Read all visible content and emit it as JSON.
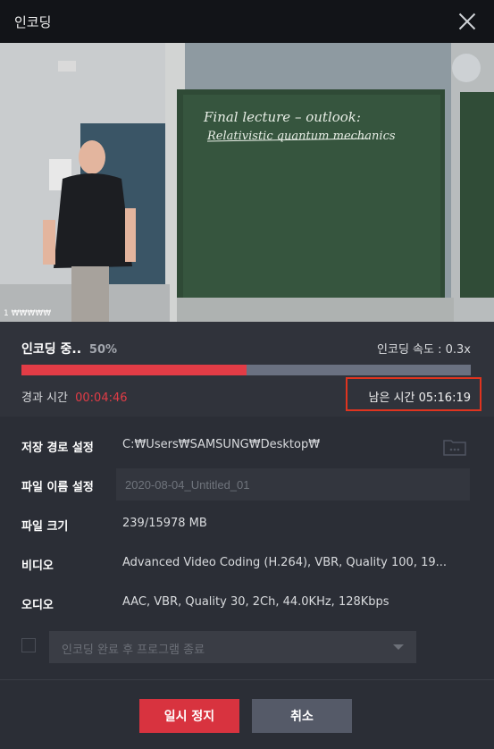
{
  "window": {
    "title": "인코딩"
  },
  "progress": {
    "status_label": "인코딩 중..",
    "percent_text": "50%",
    "percent_value": 0.5,
    "speed_text": "인코딩 속도 : 0.3x",
    "elapsed_label": "경과 시간",
    "elapsed_value": "00:04:46",
    "remaining_text": "남은 시간 05:16:19"
  },
  "settings": {
    "save_path_label": "저장 경로 설정",
    "save_path_value": "C:₩Users₩SAMSUNG₩Desktop₩",
    "filename_label": "파일 이름 설정",
    "filename_placeholder": "2020-08-04_Untitled_01",
    "filesize_label": "파일 크기",
    "filesize_value": "239/15978 MB",
    "video_label": "비디오",
    "video_value": "Advanced Video Coding (H.264), VBR, Quality 100, 19...",
    "audio_label": "오디오",
    "audio_value": "AAC, VBR, Quality 30, 2Ch, 44.0KHz, 128Kbps",
    "after_complete_option": "인코딩 완료 후 프로그램 종료"
  },
  "preview": {
    "board_line1": "Final lecture – outlook:",
    "board_line2": "Relativistic quantum mechanics",
    "corner_text": "1 ₩₩₩₩₩"
  },
  "buttons": {
    "pause": "일시 정지",
    "cancel": "취소"
  },
  "icons": {
    "close": "close-icon",
    "folder": "folder-icon",
    "dropdown": "chevron-down-icon"
  },
  "colors": {
    "accent": "#e23c46",
    "highlight_border": "#e0341f"
  }
}
